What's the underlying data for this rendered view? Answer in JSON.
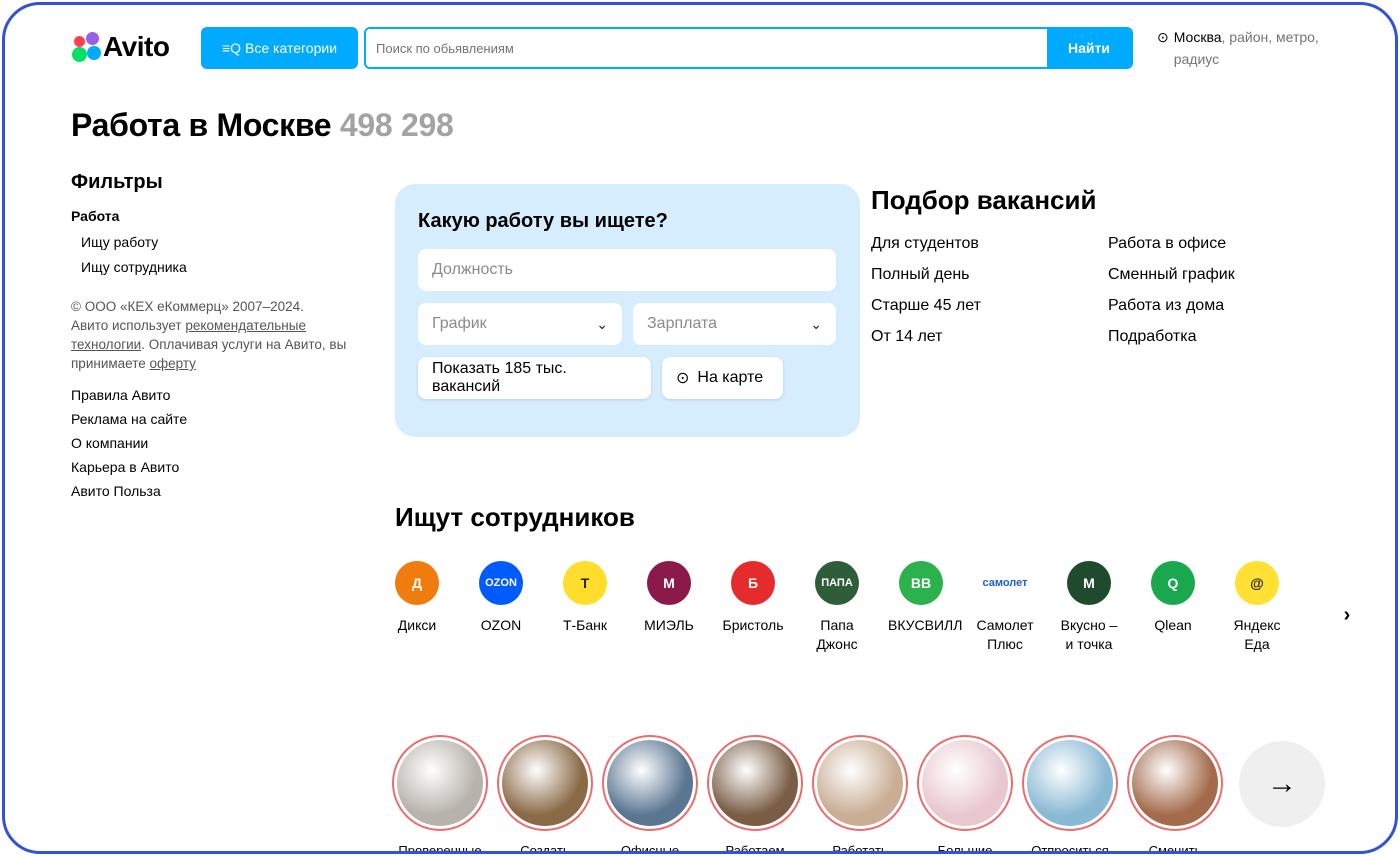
{
  "header": {
    "logo_text": "Avito",
    "categories_label": "Все категории",
    "search_placeholder": "Поиск по обьявлениям",
    "search_button": "Найти",
    "location_city": "Москва",
    "location_rest": ", район, метро, радиус"
  },
  "page": {
    "title": "Работа в Москве",
    "count": "498 298"
  },
  "sidebar": {
    "filters_title": "Фильтры",
    "section": "Работа",
    "items": [
      "Ищу работу",
      "Ищу сотрудника"
    ],
    "copyright_1": "© ООО «КЕХ еКоммерц» 2007–2024.",
    "copyright_2": "Авито использует ",
    "copyright_link1": "рекомендательные технологии",
    "copyright_3": ". Оплачивая услуги на Авито, вы принимаете ",
    "copyright_link2": "оферту",
    "links": [
      "Правила Авито",
      "Реклама на сайте",
      "О компании",
      "Карьера в Авито",
      "Авито Польза"
    ]
  },
  "search_card": {
    "title": "Какую работу вы ищете?",
    "position_placeholder": "Должность",
    "schedule_label": "График",
    "salary_label": "Зарплата",
    "show_button": "Показать 185 тыс. вакансий",
    "map_button": "На карте"
  },
  "vacancies": {
    "title": "Подбор вакансий",
    "col1": [
      "Для студентов",
      "Полный день",
      "Старше 45 лет",
      "От 14 лет"
    ],
    "col2": [
      "Работа в офисе",
      "Сменный график",
      "Работа из дома",
      "Подработка"
    ]
  },
  "employers": {
    "title": "Ищут сотрудников",
    "items": [
      {
        "name": "Дикси",
        "mark": "Д",
        "color": "#f07c0e"
      },
      {
        "name": "OZON",
        "mark": "OZON",
        "color": "#005bff"
      },
      {
        "name": "Т-Банк",
        "mark": "T",
        "color": "#ffdd2d"
      },
      {
        "name": "МИЭЛЬ",
        "mark": "М",
        "color": "#8b1a4a"
      },
      {
        "name": "Бристоль",
        "mark": "Б",
        "color": "#e52b2b"
      },
      {
        "name": "Папа Джонс",
        "mark": "ПАПА",
        "color": "#2f5d3a"
      },
      {
        "name": "ВКУСВИЛЛ",
        "mark": "BB",
        "color": "#2bb24c"
      },
      {
        "name": "Самолет Плюс",
        "mark": "самолет",
        "color": "#ffffff"
      },
      {
        "name": "Вкусно – и точка",
        "mark": "M",
        "color": "#1f4a2e"
      },
      {
        "name": "Qlean",
        "mark": "Q",
        "color": "#1aa84f"
      },
      {
        "name": "Яндекс Еда",
        "mark": "@",
        "color": "#ffe033"
      }
    ]
  },
  "stories": {
    "items": [
      {
        "label": "Проверенные",
        "color": "#b7b2ab"
      },
      {
        "label": "Создать",
        "color": "#8a6a46"
      },
      {
        "label": "Офисные",
        "color": "#5a7691"
      },
      {
        "label": "Работаем",
        "color": "#7a5d45"
      },
      {
        "label": "Работать",
        "color": "#c9ad94"
      },
      {
        "label": "Большие",
        "color": "#e9c7cf"
      },
      {
        "label": "Отпроситься",
        "color": "#8ab9d4"
      },
      {
        "label": "Сменить",
        "color": "#a36b4b"
      }
    ]
  },
  "colors": {
    "accent": "#00aaff",
    "card_bg": "#d5edfd",
    "frame_border": "#3551d6",
    "story_ring": "#ec6d6d"
  }
}
